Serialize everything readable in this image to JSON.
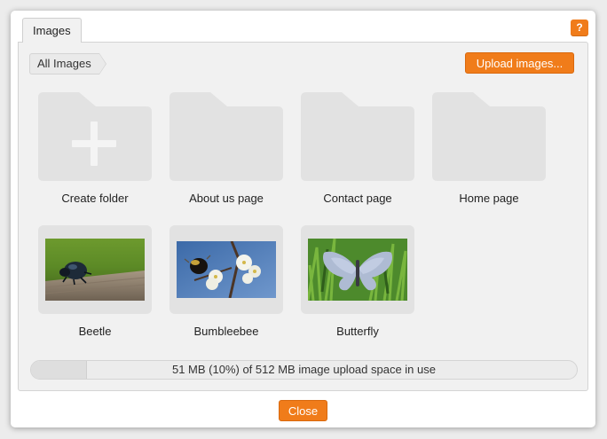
{
  "dialog": {
    "tab_label": "Images",
    "help_label": "?",
    "close_label": "Close"
  },
  "breadcrumb": {
    "items": [
      {
        "label": "All Images"
      }
    ]
  },
  "toolbar": {
    "upload_label": "Upload images..."
  },
  "folders": [
    {
      "label": "Create folder",
      "icon": "folder-plus-icon"
    },
    {
      "label": "About us page",
      "icon": "folder-icon"
    },
    {
      "label": "Contact page",
      "icon": "folder-icon"
    },
    {
      "label": "Home page",
      "icon": "folder-icon"
    }
  ],
  "images": [
    {
      "label": "Beetle"
    },
    {
      "label": "Bumbleebee"
    },
    {
      "label": "Butterfly"
    }
  ],
  "usage": {
    "text": "51 MB (10%) of 512 MB image upload space in use",
    "fraction": 0.1
  },
  "colors": {
    "accent": "#f07c1a",
    "folder": "#e2e2e2",
    "panel": "#f1f1f1"
  }
}
